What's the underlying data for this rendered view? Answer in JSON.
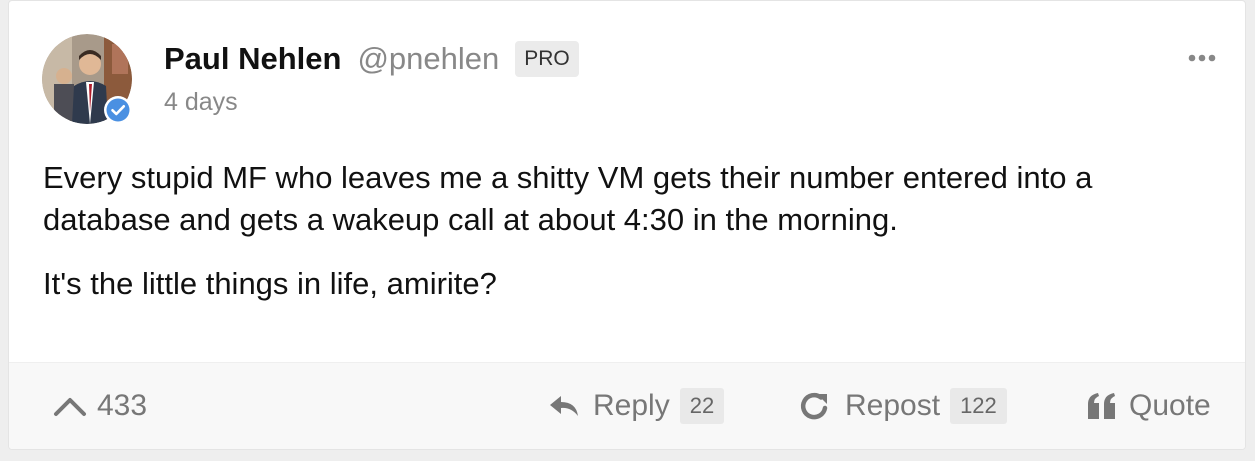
{
  "post": {
    "author_name": "Paul Nehlen",
    "author_handle": "@pnehlen",
    "badge": "PRO",
    "time": "4 days",
    "paragraphs": [
      "Every stupid MF who leaves me a shitty VM gets their number entered into a database and gets a wakeup call at about 4:30 in the morning.",
      "It's the little things in life, amirite?"
    ]
  },
  "actions": {
    "upvote_count": "433",
    "reply_label": "Reply",
    "reply_count": "22",
    "repost_label": "Repost",
    "repost_count": "122",
    "quote_label": "Quote"
  },
  "icons": {
    "avatar": "avatar",
    "verified": "verified-check-icon",
    "more": "more-dots-icon",
    "upvote": "chevron-up-icon",
    "reply": "reply-arrow-icon",
    "repost": "repost-icon",
    "quote": "quote-icon"
  },
  "colors": {
    "verified_blue": "#4a90e2",
    "muted_text": "#888888",
    "footer_bg": "#f8f8f8"
  }
}
